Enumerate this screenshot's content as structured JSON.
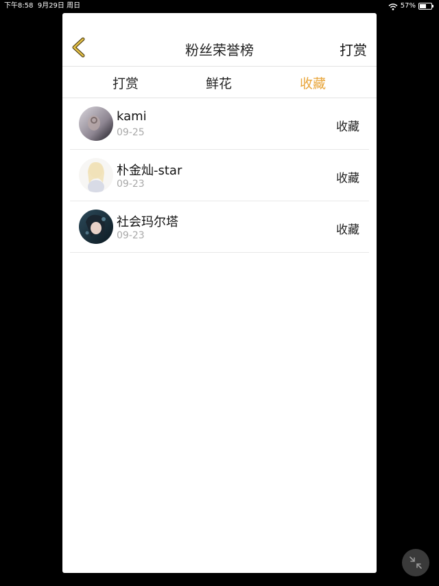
{
  "status_bar": {
    "time": "下午8:58",
    "date": "9月29日 周日",
    "battery": "57%",
    "battery_level": 0.57,
    "wifi_icon": "wifi-icon",
    "battery_icon": "battery-icon"
  },
  "nav": {
    "back_icon": "chevron-left-icon",
    "title": "粉丝荣誉榜",
    "right_label": "打赏"
  },
  "tabs": [
    {
      "label": "打赏",
      "active": false
    },
    {
      "label": "鲜花",
      "active": false
    },
    {
      "label": "收藏",
      "active": true
    }
  ],
  "list": [
    {
      "name": "kami",
      "date": "09-25",
      "action": "收藏"
    },
    {
      "name": "朴金灿-star",
      "date": "09-23",
      "action": "收藏"
    },
    {
      "name": "社会玛尔塔",
      "date": "09-23",
      "action": "收藏"
    }
  ],
  "colors": {
    "accent": "#e8a53a",
    "divider": "#e3e3e3",
    "background": "#000000"
  },
  "floating_button_icon": "collapse-arrows-icon"
}
